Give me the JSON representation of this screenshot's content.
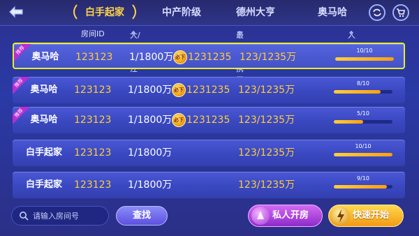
{
  "tabs": [
    {
      "label": "白手起家",
      "active": true
    },
    {
      "label": "中产阶级",
      "active": false
    },
    {
      "label": "德州大亨",
      "active": false
    },
    {
      "label": "奥马哈",
      "active": false
    }
  ],
  "header": {
    "room_id": "房间ID",
    "blinds": "大/小盲注",
    "min_buyin": "最小/大携带",
    "players": "人数"
  },
  "rows": [
    {
      "name": "奥马哈",
      "badge": "推荐",
      "room_id": "123123",
      "blinds": "1/1800万",
      "coin": "必下",
      "bet": "1231235",
      "buyin": "123/1235万",
      "players": "10/10",
      "fill": 1.0,
      "selected": true
    },
    {
      "name": "奥马哈",
      "badge": "推荐",
      "room_id": "123123",
      "blinds": "1/1800万",
      "coin": "必下",
      "bet": "1231235",
      "buyin": "123/1235万",
      "players": "8/10",
      "fill": 0.8,
      "selected": false
    },
    {
      "name": "奥马哈",
      "badge": "推荐",
      "room_id": "123123",
      "blinds": "1/1800万",
      "coin": "必下",
      "bet": "1231235",
      "buyin": "123/1235万",
      "players": "5/10",
      "fill": 0.5,
      "selected": false
    },
    {
      "name": "白手起家",
      "badge": "",
      "room_id": "123123",
      "blinds": "1/1800万",
      "coin": "",
      "bet": "",
      "buyin": "123/1235万",
      "players": "10/10",
      "fill": 1.0,
      "selected": false
    },
    {
      "name": "白手起家",
      "badge": "",
      "room_id": "123123",
      "blinds": "1/1800万",
      "coin": "",
      "bet": "",
      "buyin": "123/1235万",
      "players": "9/10",
      "fill": 0.9,
      "selected": false
    }
  ],
  "search": {
    "placeholder": "请输入房间号"
  },
  "buttons": {
    "find": "查找",
    "private_room": "私人开房",
    "quick_start": "快速开始"
  },
  "icons": {
    "back": "back-arrow-icon",
    "refresh": "refresh-icon",
    "shop": "cart-icon",
    "search": "search-icon"
  },
  "colors": {
    "accent_gold": "#ffce3a",
    "selected_border": "#e8ef2b",
    "badge": "#b52fd4"
  }
}
